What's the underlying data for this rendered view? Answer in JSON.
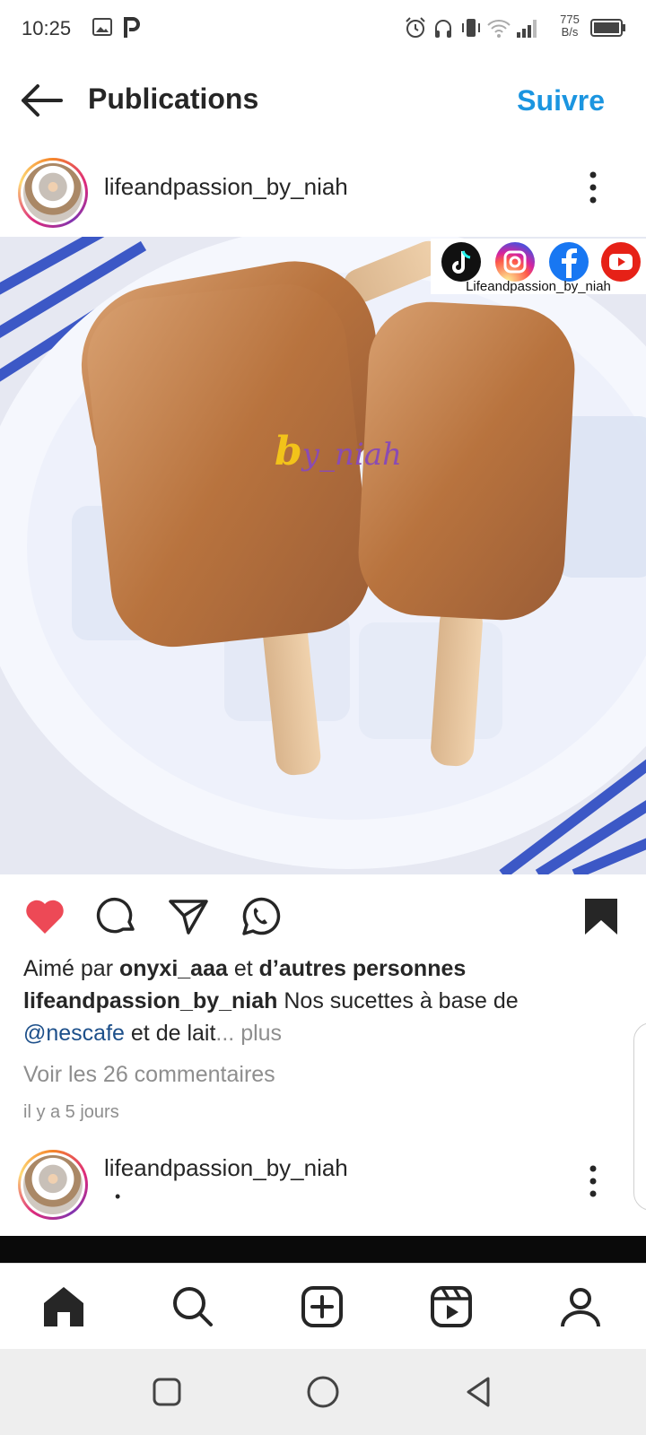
{
  "status_bar": {
    "time": "10:25",
    "net_speed_value": "775",
    "net_speed_unit": "B/s"
  },
  "header": {
    "title": "Publications",
    "follow_label": "Suivre"
  },
  "post": {
    "username": "lifeandpassion_by_niah",
    "photo": {
      "social_caption": "Lifeandpassion_by_niah",
      "watermark_b": "b",
      "watermark_rest": "y_niah"
    },
    "likes_prefix": "Aimé par ",
    "likes_user": "onyxi_aaa",
    "likes_middle": " et ",
    "likes_others": "d’autres personnes",
    "caption_user": "lifeandpassion_by_niah",
    "caption_text": " Nos sucettes à base de",
    "caption_mention": "@nescafe",
    "caption_text2": " et de lait",
    "caption_more": "... plus",
    "comments_link": "Voir les 26 commentaires",
    "timestamp": "il y a 5 jours",
    "liked": true,
    "saved": true
  },
  "next_post": {
    "username": "lifeandpassion_by_niah",
    "subline": "•"
  },
  "colors": {
    "accent": "#1b95e0",
    "like": "#ed4956",
    "text": "#262626",
    "muted": "#8e8e8e",
    "mention": "#1c4f8a"
  },
  "icons": {
    "bottom_nav": [
      "home-icon",
      "search-icon",
      "add-post-icon",
      "reels-icon",
      "profile-icon"
    ],
    "actions": [
      "heart-icon",
      "comment-icon",
      "share-icon",
      "whatsapp-icon",
      "bookmark-icon"
    ],
    "system_nav": [
      "recents-icon",
      "home-circle-icon",
      "back-triangle-icon"
    ]
  }
}
